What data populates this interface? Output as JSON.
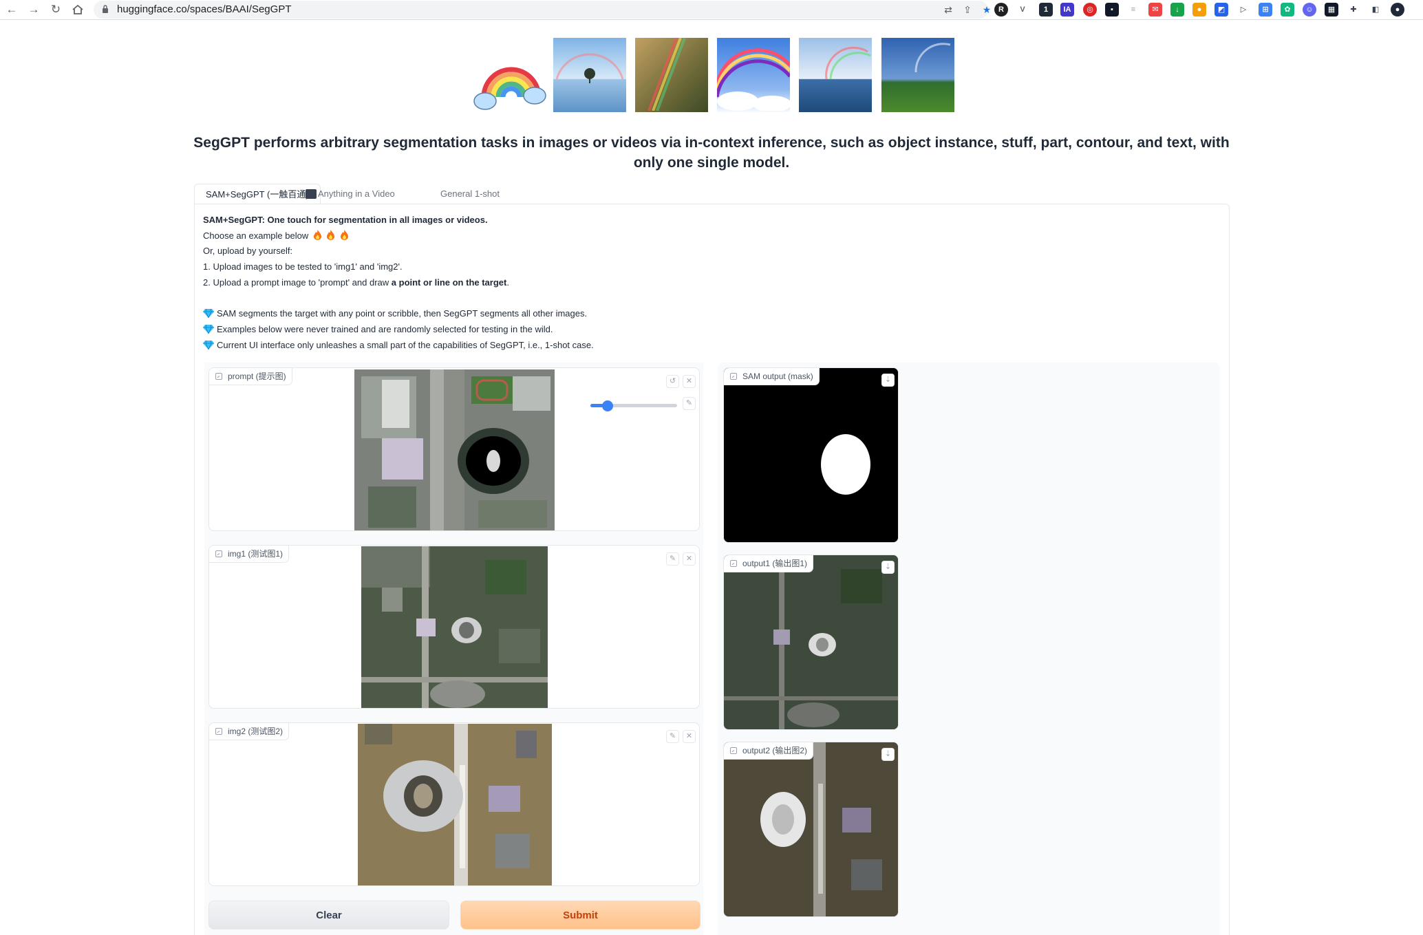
{
  "browser": {
    "url": "huggingface.co/spaces/BAAI/SegGPT"
  },
  "headline": "SegGPT performs arbitrary segmentation tasks in images or videos via in-context inference, such as object instance, stuff, part, contour, and text, with only one single model.",
  "tabs": [
    {
      "label": "SAM+SegGPT (一触百通)",
      "active": true
    },
    {
      "label": "Anything in a Video",
      "active": false
    },
    {
      "label": "General 1-shot",
      "active": false
    }
  ],
  "description": {
    "title": "SAM+SegGPT: One touch for segmentation in all images or videos.",
    "choose": "Choose an example below",
    "upload": "Or, upload by yourself:",
    "step1": "1. Upload images to be tested to 'img1' and 'img2'.",
    "step2_prefix": "2. Upload a prompt image to 'prompt' and draw ",
    "step2_bold": "a point or line on the target",
    "step2_suffix": ".",
    "note1": "SAM segments the target with any point or scribble, then SegGPT segments all other images.",
    "note2": "Examples below were never trained and are randomly selected for testing in the wild.",
    "note3": "Current UI interface only unleashes a small part of the capabilities of SegGPT, i.e., 1-shot case."
  },
  "inputs": {
    "prompt": {
      "label": "prompt (提示图)"
    },
    "img1": {
      "label": "img1 (测试图1)"
    },
    "img2": {
      "label": "img2 (测试图2)"
    },
    "brush_size": 0.2
  },
  "outputs": {
    "sam": {
      "label": "SAM output (mask)"
    },
    "out1": {
      "label": "output1 (输出图1)"
    },
    "out2": {
      "label": "output2 (输出图2)"
    }
  },
  "buttons": {
    "clear": "Clear",
    "submit": "Submit"
  }
}
